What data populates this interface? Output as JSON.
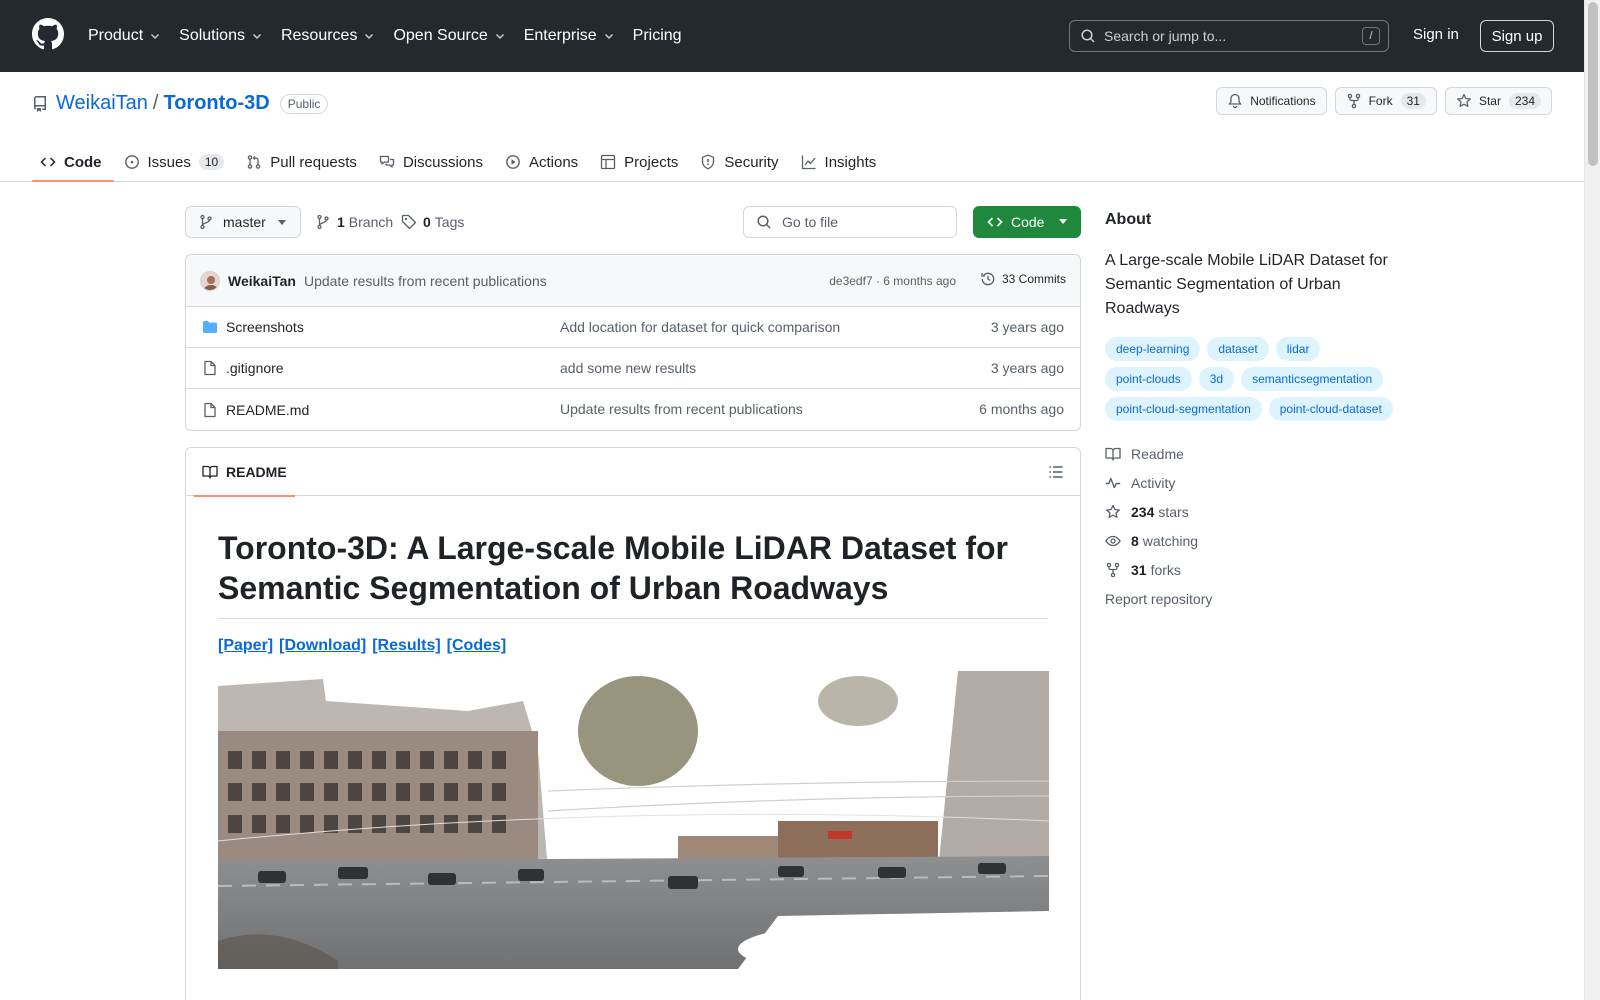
{
  "header": {
    "nav": [
      "Product",
      "Solutions",
      "Resources",
      "Open Source",
      "Enterprise",
      "Pricing"
    ],
    "search_placeholder": "Search or jump to...",
    "search_shortcut": "/",
    "sign_in": "Sign in",
    "sign_up": "Sign up"
  },
  "repo": {
    "owner": "WeikaiTan",
    "separator": "/",
    "name": "Toronto-3D",
    "visibility": "Public",
    "notifications_label": "Notifications",
    "fork_label": "Fork",
    "fork_count": "31",
    "star_label": "Star",
    "star_count": "234"
  },
  "tabs": [
    {
      "label": "Code",
      "active": true
    },
    {
      "label": "Issues",
      "count": "10"
    },
    {
      "label": "Pull requests"
    },
    {
      "label": "Discussions"
    },
    {
      "label": "Actions"
    },
    {
      "label": "Projects"
    },
    {
      "label": "Security"
    },
    {
      "label": "Insights"
    }
  ],
  "toolbar": {
    "branch": "master",
    "branch_count": "1",
    "branch_label": "Branch",
    "tag_count": "0",
    "tag_label": "Tags",
    "goto_placeholder": "Go to file",
    "code_label": "Code"
  },
  "commit": {
    "author": "WeikaiTan",
    "message": "Update results from recent publications",
    "meta": "de3edf7 · 6 months ago",
    "commits": "33 Commits"
  },
  "files": [
    {
      "name": "Screenshots",
      "type": "folder",
      "message": "Add location for dataset for quick comparison",
      "age": "3 years ago"
    },
    {
      "name": ".gitignore",
      "type": "file",
      "message": "add some new results",
      "age": "3 years ago"
    },
    {
      "name": "README.md",
      "type": "file",
      "message": "Update results from recent publications",
      "age": "6 months ago"
    }
  ],
  "readme": {
    "tab_label": "README",
    "title": "Toronto-3D: A Large-scale Mobile LiDAR Dataset for Semantic Segmentation of Urban Roadways",
    "links": [
      "[Paper]",
      "[Download]",
      "[Results]",
      "[Codes]"
    ]
  },
  "about": {
    "title": "About",
    "description": "A Large-scale Mobile LiDAR Dataset for Semantic Segmentation of Urban Roadways",
    "topics": [
      "deep-learning",
      "dataset",
      "lidar",
      "point-clouds",
      "3d",
      "semanticsegmentation",
      "point-cloud-segmentation",
      "point-cloud-dataset"
    ],
    "readme_label": "Readme",
    "activity_label": "Activity",
    "stars_count": "234",
    "stars_label": "stars",
    "watching_count": "8",
    "watching_label": "watching",
    "forks_count": "31",
    "forks_label": "forks",
    "report_label": "Report repository"
  },
  "colors": {
    "header_bg": "#24292f",
    "link": "#0969da",
    "primary_button": "#1f883d",
    "active_tab_underline": "#fd8c73",
    "topic_bg": "#ddf4ff"
  }
}
